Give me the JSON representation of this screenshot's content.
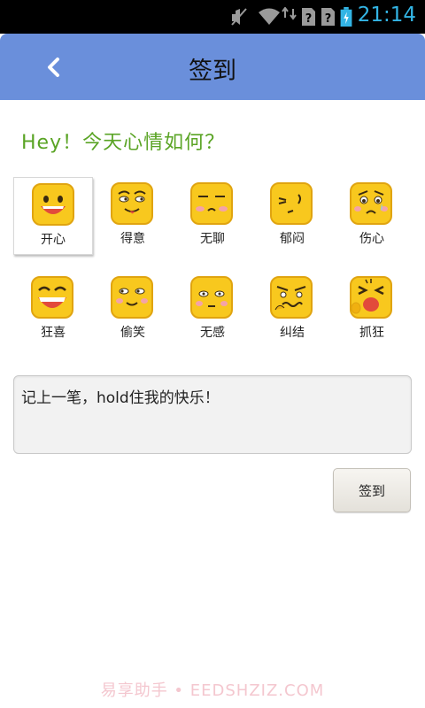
{
  "status_bar": {
    "time": "21:14",
    "icons": [
      "mute-icon",
      "wifi-icon",
      "data-transfer-icon",
      "no-sim-icon",
      "no-sim-icon",
      "battery-charging-icon"
    ]
  },
  "header": {
    "title": "签到",
    "back_icon": "chevron-left-icon"
  },
  "greeting": "Hey！今天心情如何？",
  "moods": [
    {
      "label": "开心",
      "selected": true
    },
    {
      "label": "得意",
      "selected": false
    },
    {
      "label": "无聊",
      "selected": false
    },
    {
      "label": "郁闷",
      "selected": false
    },
    {
      "label": "伤心",
      "selected": false
    },
    {
      "label": "狂喜",
      "selected": false
    },
    {
      "label": "偷笑",
      "selected": false
    },
    {
      "label": "无感",
      "selected": false
    },
    {
      "label": "纠结",
      "selected": false
    },
    {
      "label": "抓狂",
      "selected": false
    }
  ],
  "note": {
    "value": "记上一笔，hold住我的快乐！"
  },
  "submit_label": "签到",
  "watermark": "易享助手 • EEDSHZIZ.COM",
  "colors": {
    "header": "#6a8fdb",
    "greeting": "#5aa425",
    "status_accent": "#33b5e5",
    "emoji_yellow": "#f8c81e"
  }
}
